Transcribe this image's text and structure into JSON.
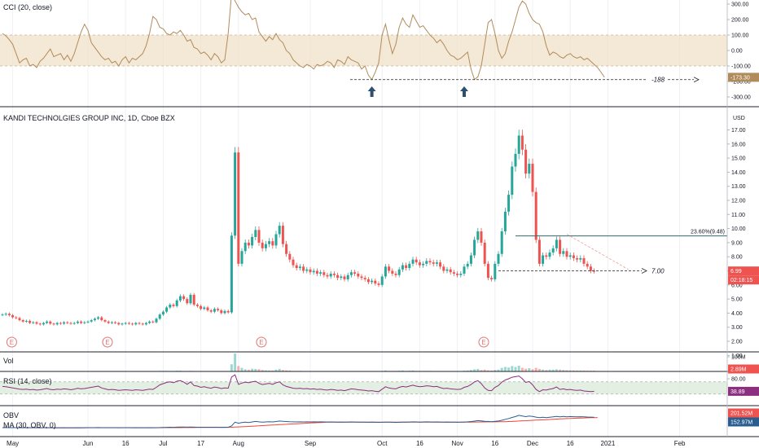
{
  "colors": {
    "up": "#26a69a",
    "down": "#ef5350",
    "cci": "#b08c5c",
    "cci_band": "#f0e0c8",
    "rsi": "#8b2f7e",
    "rsi_band": "#dcebdc",
    "obv": "#2a5d8f",
    "obv_ma": "#f44336",
    "divider": "#1e222d",
    "grid": "#eef0f3",
    "annotation": "#222222",
    "arrow": "#2f4f6f",
    "fib": "#2e6b6b",
    "earnings": "#e57373"
  },
  "panes": {
    "cci": {
      "label": "CCI (20, close)",
      "ticks": [
        "300.00",
        "200.00",
        "100.00",
        "0.00",
        "-100.00",
        "-200.00",
        "-300.00"
      ],
      "last_label": "-173.30",
      "line_label": "-188"
    },
    "price": {
      "label": "KANDI TECHNOLGIES GROUP INC, 1D, Cboe BZX",
      "currency": "USD",
      "ticks": [
        "17.00",
        "16.00",
        "15.00",
        "14.00",
        "13.00",
        "12.00",
        "11.00",
        "10.00",
        "9.00",
        "8.00",
        "7.00",
        "6.00",
        "5.00",
        "4.00",
        "3.00",
        "2.00",
        "1.00"
      ],
      "last_label": "6.99",
      "countdown": "02:18:15",
      "fib_label": "23.60%(9.48)",
      "support_label": "7.00",
      "earnings_marker": "E"
    },
    "vol": {
      "label": "Vol",
      "ticks": [
        "100M"
      ],
      "last_label": "2.89M"
    },
    "rsi": {
      "label": "RSI (14, close)",
      "ticks": [
        "80.00"
      ],
      "last_label": "38.89"
    },
    "obv": {
      "label": "OBV",
      "label2": "MA (30, OBV, 0)",
      "last_obv": "201.52M",
      "last_ma": "152.97M"
    }
  },
  "x_axis": {
    "labels": [
      {
        "text": "May",
        "i": 3
      },
      {
        "text": "Jun",
        "i": 25
      },
      {
        "text": "16",
        "i": 36
      },
      {
        "text": "Jul",
        "i": 47
      },
      {
        "text": "17",
        "i": 58
      },
      {
        "text": "Aug",
        "i": 69
      },
      {
        "text": "Sep",
        "i": 90
      },
      {
        "text": "Oct",
        "i": 111
      },
      {
        "text": "16",
        "i": 122
      },
      {
        "text": "Nov",
        "i": 133
      },
      {
        "text": "16",
        "i": 144
      },
      {
        "text": "Dec",
        "i": 155
      },
      {
        "text": "16",
        "i": 166
      },
      {
        "text": "2021",
        "i": 177
      },
      {
        "text": "Feb",
        "i": 198
      }
    ]
  },
  "chart_data": {
    "type": "candlestick",
    "title": "KANDI TECHNOLGIES GROUP INC, 1D, Cboe BZX",
    "y_range": [
      1,
      17.9
    ],
    "earnings_index": [
      2,
      30,
      75,
      140
    ],
    "support": {
      "value": 7.0,
      "from_index": 145,
      "to_index": 186
    },
    "fib_level": {
      "value": 9.48,
      "from_index": 150,
      "to_index": 211
    },
    "close": [
      3.9,
      3.95,
      3.85,
      3.7,
      3.65,
      3.5,
      3.4,
      3.45,
      3.3,
      3.35,
      3.25,
      3.2,
      3.3,
      3.4,
      3.25,
      3.2,
      3.3,
      3.25,
      3.35,
      3.3,
      3.25,
      3.3,
      3.4,
      3.3,
      3.35,
      3.4,
      3.5,
      3.6,
      3.7,
      3.5,
      3.4,
      3.3,
      3.35,
      3.3,
      3.2,
      3.25,
      3.3,
      3.25,
      3.2,
      3.3,
      3.25,
      3.2,
      3.3,
      3.4,
      3.35,
      3.6,
      3.9,
      4.1,
      4.4,
      4.6,
      4.5,
      4.9,
      5.2,
      5.0,
      4.7,
      5.3,
      4.6,
      4.5,
      4.3,
      4.4,
      4.2,
      4.1,
      4.3,
      4.2,
      4.0,
      4.15,
      4.05,
      9.5,
      15.4,
      7.5,
      8.4,
      9.0,
      8.8,
      9.4,
      9.9,
      9.0,
      8.6,
      8.9,
      9.1,
      8.8,
      9.6,
      10.2,
      8.9,
      8.2,
      7.8,
      7.4,
      7.2,
      7.3,
      7.0,
      7.1,
      6.9,
      7.0,
      6.8,
      6.9,
      6.7,
      6.6,
      6.8,
      6.7,
      6.5,
      6.6,
      6.4,
      6.7,
      6.9,
      6.8,
      6.6,
      6.5,
      6.4,
      6.2,
      6.3,
      6.1,
      6.0,
      6.6,
      7.3,
      7.0,
      6.8,
      6.7,
      7.1,
      7.4,
      7.2,
      7.5,
      7.8,
      7.6,
      7.4,
      7.5,
      7.7,
      7.6,
      7.5,
      7.6,
      7.3,
      7.0,
      7.1,
      6.9,
      6.8,
      6.7,
      6.8,
      7.3,
      7.5,
      8.1,
      9.2,
      9.8,
      9.0,
      7.5,
      6.5,
      6.4,
      7.5,
      8.2,
      9.8,
      11.2,
      12.4,
      14.4,
      15.3,
      16.6,
      15.6,
      13.9,
      14.6,
      12.6,
      9.2,
      7.5,
      8.1,
      8.0,
      8.3,
      8.6,
      9.2,
      8.2,
      8.4,
      8.0,
      8.1,
      7.9,
      7.8,
      7.9,
      7.5,
      7.3,
      7.0,
      6.99
    ],
    "volume": [
      2,
      1,
      1,
      1,
      1,
      1,
      1,
      1,
      1,
      1,
      1,
      1,
      1,
      1,
      1,
      1,
      1,
      1,
      1,
      1,
      1,
      1,
      1,
      1,
      1,
      2,
      1,
      1,
      1,
      1,
      1,
      1,
      1,
      1,
      1,
      1,
      1,
      1,
      1,
      1,
      1,
      1,
      1,
      1,
      1,
      2,
      3,
      3,
      3,
      2,
      2,
      4,
      4,
      2,
      2,
      3,
      2,
      2,
      1,
      1,
      1,
      1,
      1,
      1,
      1,
      1,
      1,
      40,
      100,
      30,
      20,
      12,
      10,
      15,
      14,
      12,
      8,
      6,
      5,
      5,
      10,
      14,
      8,
      6,
      5,
      3,
      3,
      3,
      2,
      2,
      2,
      2,
      2,
      2,
      2,
      2,
      2,
      2,
      2,
      2,
      2,
      2,
      2,
      2,
      2,
      2,
      2,
      2,
      2,
      2,
      2,
      3,
      5,
      3,
      3,
      3,
      4,
      5,
      3,
      4,
      5,
      3,
      3,
      3,
      3,
      3,
      2,
      2,
      2,
      2,
      2,
      2,
      2,
      2,
      2,
      4,
      5,
      8,
      12,
      14,
      8,
      10,
      6,
      5,
      8,
      10,
      20,
      25,
      22,
      30,
      25,
      32,
      20,
      15,
      18,
      12,
      20,
      14,
      10,
      8,
      10,
      10,
      12,
      10,
      8,
      7,
      6,
      6,
      5,
      5,
      5,
      4,
      4,
      4,
      3,
      3
    ],
    "cci": [
      110,
      95,
      70,
      40,
      -20,
      -80,
      -60,
      -50,
      -100,
      -90,
      -110,
      -70,
      -50,
      -20,
      10,
      -40,
      -30,
      -20,
      -60,
      -30,
      -70,
      -20,
      50,
      120,
      170,
      130,
      50,
      20,
      -10,
      -40,
      -60,
      -50,
      -80,
      -70,
      -100,
      -60,
      -40,
      -80,
      -50,
      -60,
      -40,
      -20,
      30,
      110,
      220,
      200,
      150,
      140,
      110,
      100,
      120,
      110,
      130,
      100,
      60,
      70,
      20,
      10,
      -20,
      -10,
      -30,
      -60,
      -20,
      -40,
      -80,
      -60,
      110,
      370,
      320,
      280,
      250,
      230,
      240,
      200,
      210,
      120,
      90,
      60,
      90,
      70,
      110,
      70,
      50,
      0,
      -20,
      -60,
      -80,
      -100,
      -110,
      -90,
      -100,
      -120,
      -90,
      -100,
      -90,
      -70,
      -80,
      -110,
      -60,
      -70,
      -90,
      -40,
      -60,
      -70,
      -80,
      -120,
      -100,
      -160,
      -188,
      -140,
      -80,
      100,
      170,
      70,
      -20,
      40,
      150,
      210,
      170,
      150,
      230,
      190,
      150,
      160,
      130,
      100,
      80,
      50,
      70,
      40,
      0,
      -30,
      -40,
      -60,
      -50,
      -30,
      -10,
      -120,
      -188,
      -170,
      -100,
      40,
      180,
      200,
      110,
      0,
      -50,
      -20,
      60,
      120,
      200,
      280,
      320,
      300,
      240,
      200,
      180,
      170,
      120,
      30,
      -30,
      -10,
      -20,
      -40,
      -50,
      -30,
      -20,
      -40,
      -50,
      -40,
      -60,
      -50,
      -70,
      -90,
      -110,
      -140,
      -173.3
    ],
    "rsi": [
      55,
      54,
      52,
      50,
      48,
      46,
      45,
      46,
      44,
      45,
      43,
      44,
      46,
      48,
      45,
      44,
      46,
      45,
      47,
      46,
      44,
      46,
      49,
      47,
      48,
      50,
      52,
      54,
      56,
      50,
      47,
      44,
      45,
      44,
      42,
      43,
      44,
      43,
      42,
      44,
      43,
      42,
      44,
      46,
      45,
      52,
      60,
      64,
      68,
      70,
      67,
      72,
      74,
      69,
      62,
      70,
      58,
      56,
      52,
      54,
      51,
      49,
      53,
      51,
      48,
      50,
      49,
      86,
      93,
      62,
      66,
      69,
      67,
      70,
      72,
      65,
      61,
      63,
      65,
      62,
      67,
      70,
      60,
      55,
      52,
      49,
      48,
      49,
      47,
      48,
      46,
      47,
      45,
      46,
      44,
      43,
      45,
      44,
      42,
      43,
      41,
      44,
      47,
      46,
      44,
      43,
      42,
      40,
      41,
      39,
      38,
      46,
      54,
      50,
      48,
      47,
      52,
      55,
      53,
      56,
      59,
      56,
      54,
      55,
      57,
      56,
      54,
      55,
      51,
      48,
      49,
      47,
      46,
      45,
      46,
      52,
      55,
      61,
      70,
      74,
      64,
      50,
      42,
      41,
      52,
      58,
      69,
      76,
      80,
      85,
      87,
      89,
      80,
      68,
      71,
      60,
      45,
      38,
      44,
      43,
      46,
      48,
      53,
      45,
      47,
      44,
      45,
      43,
      42,
      43,
      40,
      39,
      38,
      38.89
    ],
    "obv": [
      0,
      2,
      1,
      0,
      -1,
      -2,
      -3,
      -2,
      -3,
      -2,
      -3,
      -4,
      -3,
      -2,
      -3,
      -4,
      -3,
      -4,
      -3,
      -4,
      -5,
      -4,
      -3,
      -4,
      -3,
      -1,
      0,
      1,
      2,
      1,
      0,
      -1,
      0,
      -1,
      -2,
      -1,
      0,
      -1,
      -2,
      -1,
      -2,
      -3,
      -2,
      -1,
      -2,
      0,
      3,
      6,
      9,
      11,
      9,
      13,
      17,
      15,
      13,
      16,
      14,
      12,
      11,
      12,
      11,
      10,
      11,
      10,
      9,
      10,
      9,
      49,
      149,
      119,
      139,
      151,
      141,
      156,
      170,
      158,
      150,
      156,
      161,
      156,
      166,
      180,
      172,
      166,
      161,
      158,
      155,
      158,
      156,
      158,
      156,
      158,
      156,
      158,
      156,
      154,
      156,
      154,
      152,
      154,
      152,
      154,
      156,
      154,
      152,
      150,
      148,
      146,
      148,
      146,
      144,
      147,
      152,
      149,
      146,
      143,
      147,
      152,
      149,
      153,
      158,
      155,
      152,
      155,
      158,
      155,
      153,
      155,
      153,
      151,
      153,
      151,
      149,
      147,
      149,
      153,
      158,
      166,
      178,
      192,
      184,
      174,
      168,
      163,
      171,
      181,
      201,
      226,
      248,
      278,
      303,
      335,
      315,
      300,
      318,
      306,
      286,
      272,
      282,
      274,
      284,
      294,
      306,
      296,
      304,
      296,
      302,
      298,
      294,
      298,
      293,
      289,
      286,
      283
    ],
    "obv_ma": [
      0,
      0,
      0,
      0,
      0,
      0,
      -1,
      -1,
      -1,
      -1,
      -1,
      -1,
      -1,
      -1,
      -2,
      -2,
      -2,
      -2,
      -2,
      -2,
      -2,
      -2,
      -2,
      -2,
      -2,
      -2,
      -2,
      -2,
      -2,
      -2,
      -2,
      -2,
      -2,
      -2,
      -2,
      -2,
      -2,
      -2,
      -2,
      -2,
      -2,
      -2,
      -2,
      -2,
      -2,
      -2,
      -2,
      -1,
      -1,
      0,
      0,
      1,
      1,
      2,
      2,
      3,
      3,
      4,
      4,
      5,
      5,
      6,
      6,
      7,
      7,
      8,
      8,
      10,
      15,
      19,
      24,
      29,
      34,
      39,
      45,
      50,
      55,
      60,
      66,
      71,
      76,
      82,
      87,
      92,
      97,
      102,
      107,
      112,
      117,
      122,
      126,
      131,
      135,
      140,
      144,
      148,
      152,
      154,
      152,
      152,
      152,
      152,
      152,
      152,
      152,
      152,
      152,
      152,
      152,
      152,
      152,
      152,
      152,
      152,
      152,
      152,
      152,
      152,
      152,
      152,
      152,
      152,
      152,
      152,
      152,
      152,
      152,
      152,
      152,
      152,
      152,
      152,
      151,
      151,
      151,
      151,
      151,
      152,
      153,
      154,
      155,
      156,
      157,
      157,
      158,
      159,
      161,
      163,
      166,
      170,
      175,
      181,
      186,
      190,
      196,
      201,
      205,
      209,
      214,
      218,
      223,
      228,
      233,
      237,
      242,
      246,
      250,
      254,
      258,
      262,
      265,
      268,
      271,
      274,
      276
    ]
  }
}
